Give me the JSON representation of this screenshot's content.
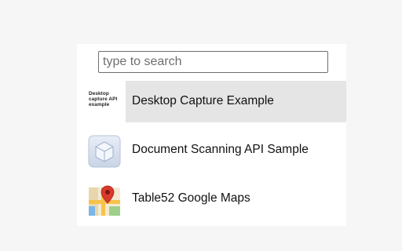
{
  "search": {
    "placeholder": "type to search",
    "value": ""
  },
  "items": [
    {
      "label": "Desktop Capture Example",
      "icon_name": "desktop-capture-text-icon",
      "icon_text": [
        "Desktop",
        "capture API",
        "example"
      ],
      "selected": true
    },
    {
      "label": "Document Scanning API Sample",
      "icon_name": "cube-placeholder-icon",
      "selected": false
    },
    {
      "label": "Table52 Google Maps",
      "icon_name": "google-maps-icon",
      "selected": false
    }
  ],
  "colors": {
    "selected_bg": "#e5e5e5",
    "page_bg": "#f6f6f6",
    "panel_bg": "#ffffff"
  }
}
